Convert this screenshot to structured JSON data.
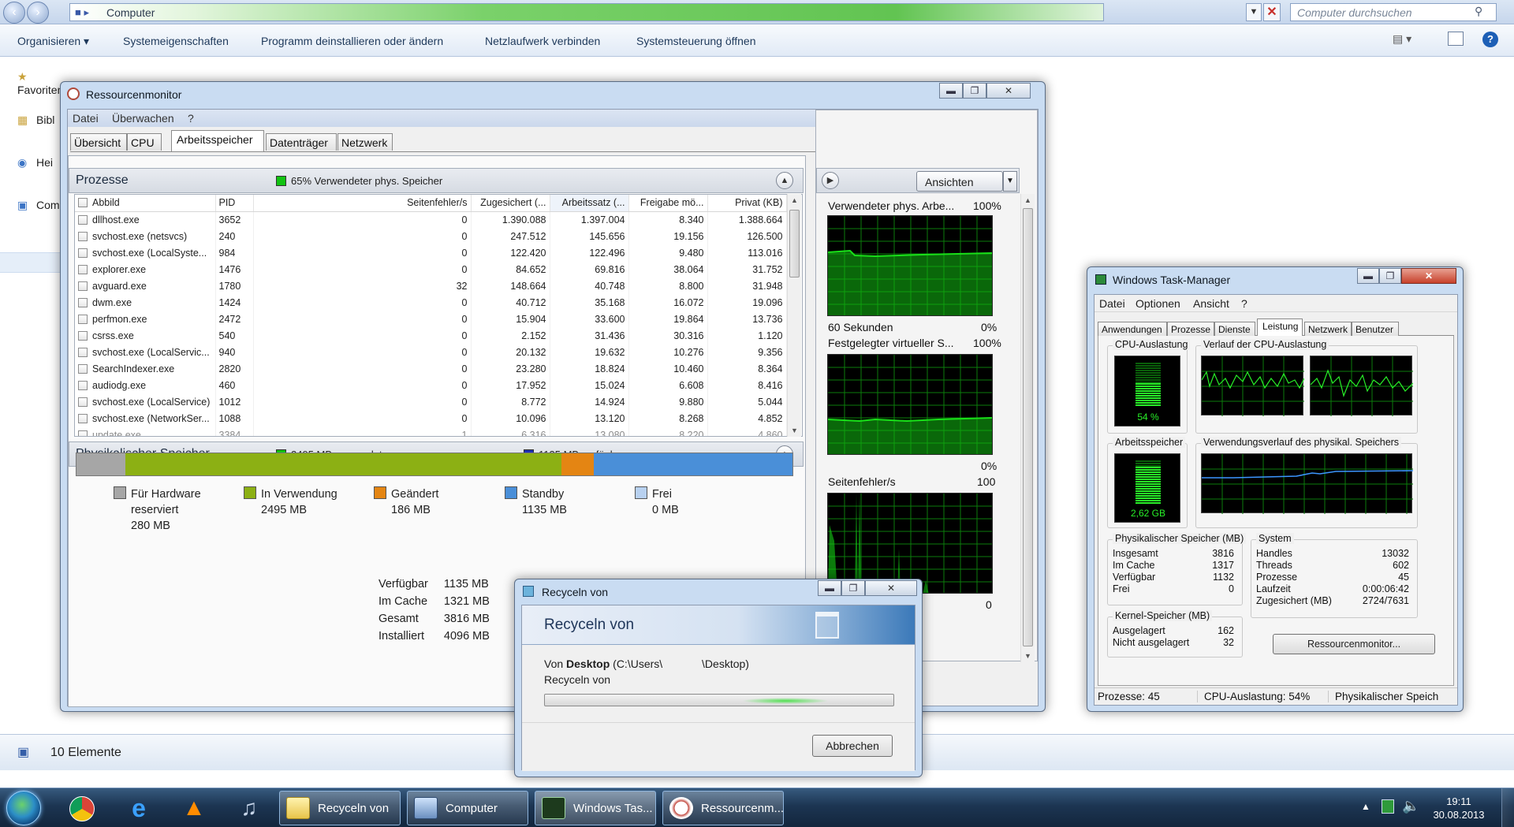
{
  "explorer": {
    "address": "Computer",
    "search_placeholder": "Computer durchsuchen",
    "toolbar": [
      "Organisieren",
      "Systemeigenschaften",
      "Programm deinstallieren oder ändern",
      "Netzlaufwerk verbinden",
      "Systemsteuerung öffnen"
    ],
    "nav": [
      "Favoriten",
      "Bibl",
      "Hei",
      "Com"
    ],
    "status": "10 Elemente"
  },
  "resmon": {
    "title": "Ressourcenmonitor",
    "menu": [
      "Datei",
      "Überwachen",
      "?"
    ],
    "tabs": [
      "Übersicht",
      "CPU",
      "Arbeitsspeicher",
      "Datenträger",
      "Netzwerk"
    ],
    "processes": {
      "header": "Prozesse",
      "badge": "65% Verwendeter phys. Speicher",
      "columns": [
        "Abbild",
        "PID",
        "Seitenfehler/s",
        "Zugesichert (...",
        "Arbeitssatz (...",
        "Freigabe mö...",
        "Privat (KB)"
      ],
      "rows": [
        [
          "dllhost.exe",
          "3652",
          "0",
          "1.390.088",
          "1.397.004",
          "8.340",
          "1.388.664"
        ],
        [
          "svchost.exe (netsvcs)",
          "240",
          "0",
          "247.512",
          "145.656",
          "19.156",
          "126.500"
        ],
        [
          "svchost.exe (LocalSyste...",
          "984",
          "0",
          "122.420",
          "122.496",
          "9.480",
          "113.016"
        ],
        [
          "explorer.exe",
          "1476",
          "0",
          "84.652",
          "69.816",
          "38.064",
          "31.752"
        ],
        [
          "avguard.exe",
          "1780",
          "32",
          "148.664",
          "40.748",
          "8.800",
          "31.948"
        ],
        [
          "dwm.exe",
          "1424",
          "0",
          "40.712",
          "35.168",
          "16.072",
          "19.096"
        ],
        [
          "perfmon.exe",
          "2472",
          "0",
          "15.904",
          "33.600",
          "19.864",
          "13.736"
        ],
        [
          "csrss.exe",
          "540",
          "0",
          "2.152",
          "31.436",
          "30.316",
          "1.120"
        ],
        [
          "svchost.exe (LocalServic...",
          "940",
          "0",
          "20.132",
          "19.632",
          "10.276",
          "9.356"
        ],
        [
          "SearchIndexer.exe",
          "2820",
          "0",
          "23.280",
          "18.824",
          "10.460",
          "8.364"
        ],
        [
          "audiodg.exe",
          "460",
          "0",
          "17.952",
          "15.024",
          "6.608",
          "8.416"
        ],
        [
          "svchost.exe (LocalService)",
          "1012",
          "0",
          "8.772",
          "14.924",
          "9.880",
          "5.044"
        ],
        [
          "svchost.exe (NetworkSer...",
          "1088",
          "0",
          "10.096",
          "13.120",
          "8.268",
          "4.852"
        ],
        [
          "update.exe",
          "3384",
          "1",
          "6.316",
          "13.080",
          "8.220",
          "4.860"
        ]
      ]
    },
    "physical": {
      "header": "Physikalischer Speicher",
      "used_badge": "2495 MB verwendet",
      "avail_badge": "1135 MB verfügbar",
      "bar_mb": [
        280,
        2495,
        186,
        1135,
        0
      ],
      "legend": [
        {
          "name": "Für Hardware",
          "sub": "reserviert",
          "value": "280 MB",
          "color": "#a6a6a6"
        },
        {
          "name": "In Verwendung",
          "sub": "",
          "value": "2495 MB",
          "color": "#8cb014"
        },
        {
          "name": "Geändert",
          "sub": "",
          "value": "186 MB",
          "color": "#e48513"
        },
        {
          "name": "Standby",
          "sub": "",
          "value": "1135 MB",
          "color": "#4a8fd8"
        },
        {
          "name": "Frei",
          "sub": "",
          "value": "0 MB",
          "color": "#b8d1f0"
        }
      ],
      "stats": [
        {
          "label": "Verfügbar",
          "value": "1135 MB"
        },
        {
          "label": "Im Cache",
          "value": "1321 MB"
        },
        {
          "label": "Gesamt",
          "value": "3816 MB"
        },
        {
          "label": "Installiert",
          "value": "4096 MB"
        }
      ]
    },
    "graphs": {
      "view_button": "Ansichten",
      "g1_title": "Verwendeter phys. Arbe...",
      "g1_max": "100%",
      "g1_footer_left": "60 Sekunden",
      "g1_footer_right": "0%",
      "g2_title": "Festgelegter virtueller S...",
      "g2_max": "100%",
      "g2_footer_right": "0%",
      "g3_title": "Seitenfehler/s",
      "g3_max": "100",
      "g3_footer_right": "0"
    }
  },
  "taskmgr": {
    "title": "Windows Task-Manager",
    "menu": [
      "Datei",
      "Optionen",
      "Ansicht",
      "?"
    ],
    "tabs": [
      "Anwendungen",
      "Prozesse",
      "Dienste",
      "Leistung",
      "Netzwerk",
      "Benutzer"
    ],
    "cpu_label": "CPU-Auslastung",
    "cpu_value": "54 %",
    "cpu_history_label": "Verlauf der CPU-Auslastung",
    "mem_label": "Arbeitsspeicher",
    "mem_value": "2,62 GB",
    "mem_history_label": "Verwendungsverlauf des physikal. Speichers",
    "phys_title": "Physikalischer Speicher (MB)",
    "phys": [
      [
        "Insgesamt",
        "3816"
      ],
      [
        "Im Cache",
        "1317"
      ],
      [
        "Verfügbar",
        "1132"
      ],
      [
        "Frei",
        "0"
      ]
    ],
    "system_title": "System",
    "system": [
      [
        "Handles",
        "13032"
      ],
      [
        "Threads",
        "602"
      ],
      [
        "Prozesse",
        "45"
      ],
      [
        "Laufzeit",
        "0:00:06:42"
      ],
      [
        "Zugesichert (MB)",
        "2724/7631"
      ]
    ],
    "kernel_title": "Kernel-Speicher (MB)",
    "kernel": [
      [
        "Ausgelagert",
        "162"
      ],
      [
        "Nicht ausgelagert",
        "32"
      ]
    ],
    "resmon_button": "Ressourcenmonitor...",
    "status": [
      "Prozesse: 45",
      "CPU-Auslastung: 54%",
      "Physikalischer Speich"
    ]
  },
  "recycle": {
    "title": "Recyceln von",
    "banner": "Recyceln von",
    "from_prefix": "Von",
    "from_bold": "Desktop",
    "from_path": "(C:\\Users\\",
    "from_path2": "\\Desktop)",
    "line2": "Recyceln von",
    "progress": 0.0,
    "cancel": "Abbrechen"
  },
  "taskbar": {
    "tasks": [
      "Recyceln von",
      "Computer",
      "Windows Tas...",
      "Ressourcenm..."
    ],
    "time": "19:11",
    "date": "30.08.2013"
  }
}
